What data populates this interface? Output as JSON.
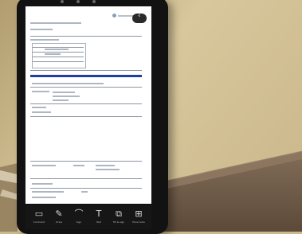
{
  "scene": {
    "colors": {
      "wall": "#cbb88c",
      "floor": "#6f5b48",
      "phone_body": "#121212",
      "screen": "#e9edf1",
      "document_accent": "#1e3fa2"
    }
  },
  "toolbar": {
    "tools": [
      {
        "icon": "comment-icon",
        "label": "Comment"
      },
      {
        "icon": "pen-icon",
        "label": "Draw"
      },
      {
        "icon": "highlighter-icon",
        "label": "Sign"
      },
      {
        "icon": "text-icon",
        "label": "Text"
      },
      {
        "icon": "fill-sign-icon",
        "label": "Fill & sign"
      },
      {
        "icon": "more-tools-icon",
        "label": "More tools"
      }
    ]
  }
}
